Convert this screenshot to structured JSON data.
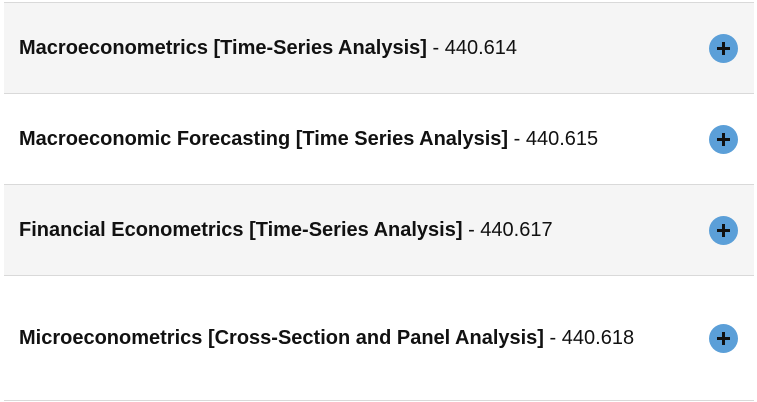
{
  "courses": [
    {
      "name": "Macroeconometrics [Time-Series Analysis]",
      "separator": "-",
      "code": "440.614",
      "icon": "plus-icon"
    },
    {
      "name": "Macroeconomic Forecasting [Time Series Analysis]",
      "separator": "-",
      "code": "440.615",
      "icon": "plus-icon"
    },
    {
      "name": "Financial Econometrics [Time-Series Analysis]",
      "separator": "-",
      "code": "440.617",
      "icon": "plus-icon"
    },
    {
      "name": "Microeconometrics [Cross-Section and Panel Analysis]",
      "separator": "-",
      "code": "440.618",
      "icon": "plus-icon"
    }
  ],
  "colors": {
    "accent": "#5b9fd8",
    "row_shade": "#f5f5f5",
    "divider": "#d9d9d9",
    "text": "#111111"
  }
}
